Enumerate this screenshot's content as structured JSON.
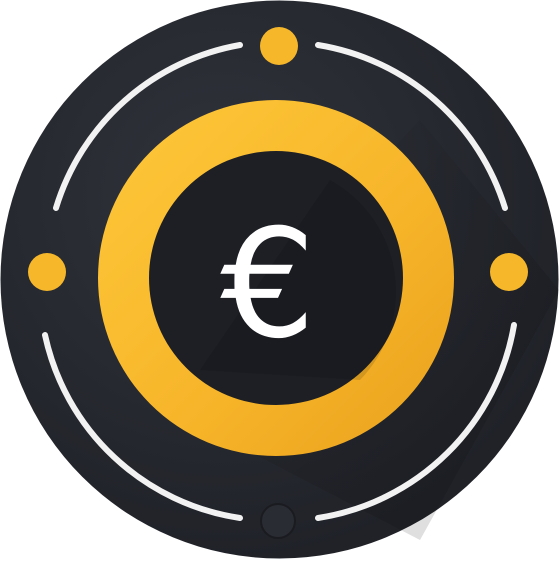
{
  "icon": {
    "name": "euro-coin-icon",
    "symbol": "€",
    "colors": {
      "outer_disc": "#23262d",
      "outer_disc_highlight": "#2d3038",
      "inner_disc": "#1d1f25",
      "ring": "#f6b72a",
      "ring_shadow": "#e8a01a",
      "ring_highlight": "#ffc93a",
      "dot": "#f6b72a",
      "bottom_dot": "#2a2c33",
      "arc_line": "#f2f2f2",
      "symbol": "#ffffff"
    }
  }
}
